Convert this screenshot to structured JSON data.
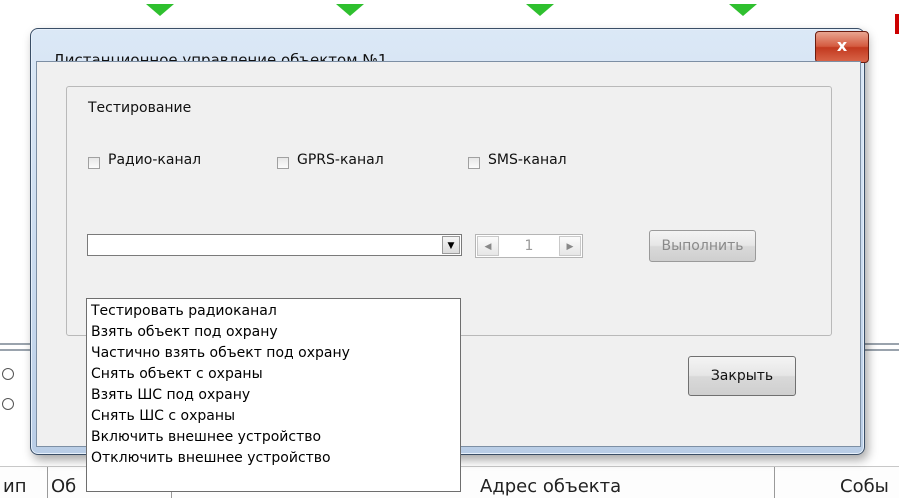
{
  "background": {
    "table_headers": [
      "ип",
      "Об",
      "Адрес объекта",
      "Собы"
    ]
  },
  "dialog": {
    "title": "Дистанционное управление объектом №1",
    "close_glyph": "x",
    "group_label": "Тестирование",
    "channels": [
      {
        "label": "Радио-канал",
        "checked": false
      },
      {
        "label": "GPRS-канал",
        "checked": false
      },
      {
        "label": "SMS-канал",
        "checked": false
      }
    ],
    "command_combo": {
      "value": "",
      "expanded": true,
      "options": [
        "Тестировать радиоканал",
        "Взять объект под охрану",
        "Частично взять объект под охрану",
        "Снять объект с охраны",
        "Взять ШС под охрану",
        "Снять ШС с охраны",
        "Включить внешнее устройство",
        "Отключить внешнее устройство"
      ]
    },
    "spinner": {
      "value": "1",
      "enabled": false
    },
    "execute_label": "Выполнить",
    "close_label": "Закрыть"
  },
  "colors": {
    "marker_green": "#2fc02f",
    "close_button_red": "#c2391f",
    "window_frame": "#c9daee"
  }
}
